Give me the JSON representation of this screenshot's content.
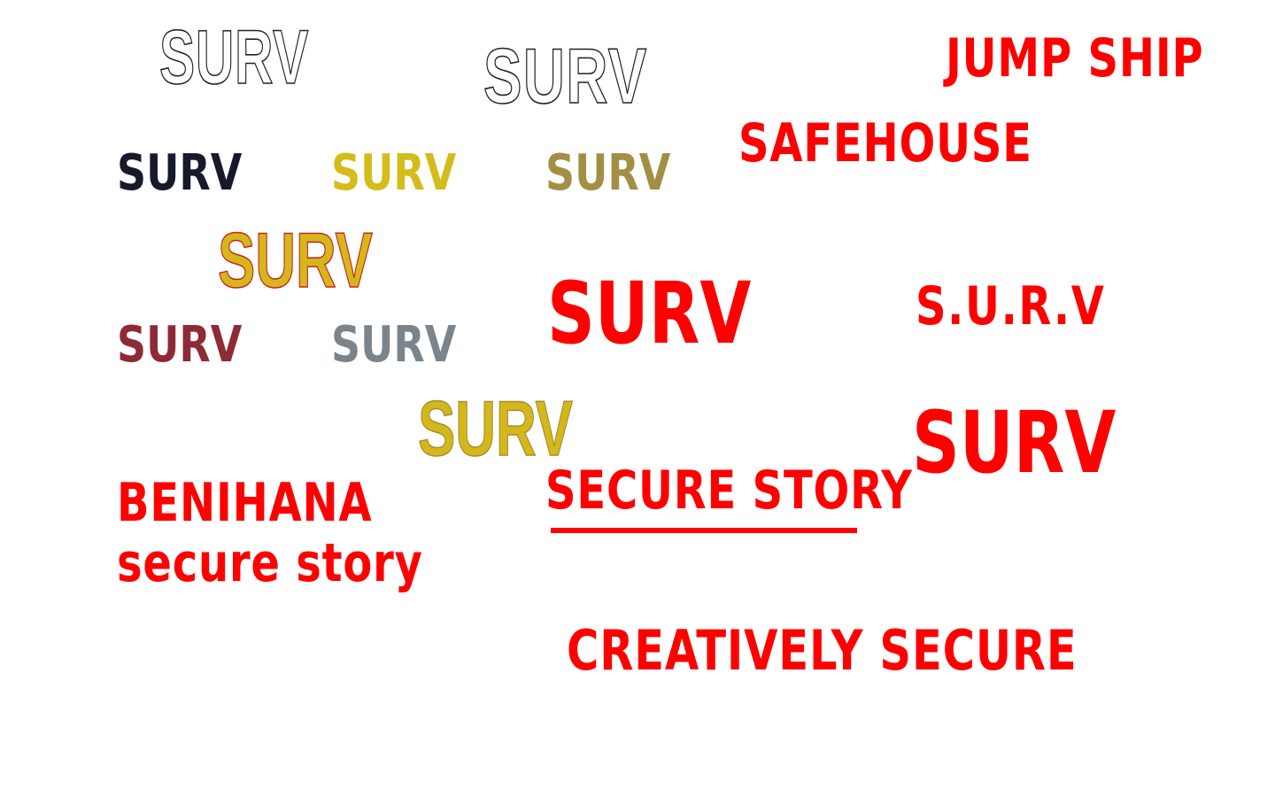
{
  "wordmarks": {
    "outline_surv_1": {
      "text": "SURV",
      "color": "#ffffff",
      "stroke": "#222222"
    },
    "outline_surv_2": {
      "text": "SURV",
      "color": "#ffffff",
      "stroke": "#222222"
    },
    "jump_ship": {
      "text": "JUMP SHIP",
      "color": "#ff0000"
    },
    "surv_navy": {
      "text": "SURV",
      "color": "#161a2b"
    },
    "surv_yellow": {
      "text": "SURV",
      "color": "#d4bc1c"
    },
    "surv_olive": {
      "text": "SURV",
      "color": "#a38f44"
    },
    "safehouse": {
      "text": "SAFEHOUSE",
      "color": "#ff0000"
    },
    "surv_gold_red_outline": {
      "text": "SURV",
      "color": "#d4b81b",
      "stroke": "#d11d1d"
    },
    "surv_stylized_1": {
      "text": "SURV",
      "color": "#ff0000"
    },
    "surv_dotted": {
      "text": "S.U.R.V",
      "color": "#ff0000"
    },
    "surv_maroon": {
      "text": "SURV",
      "color": "#8e2a35"
    },
    "surv_grey": {
      "text": "SURV",
      "color": "#7b848a"
    },
    "surv_gold_outline": {
      "text": "SURV",
      "color": "#d4b81b",
      "stroke": "#a38f2a"
    },
    "surv_stylized_2": {
      "text": "SURV",
      "color": "#ff0000"
    },
    "benihana": {
      "text": "BENIHANA",
      "color": "#ff0000"
    },
    "secure_story_lower": {
      "text": "secure story",
      "color": "#ff0000"
    },
    "secure_story_upper": {
      "text": "SECURE STORY",
      "color": "#ff0000",
      "underline_color": "#ff0000"
    },
    "creatively_secure": {
      "text": "CREATIVELY SECURE",
      "color": "#ff0000"
    }
  }
}
